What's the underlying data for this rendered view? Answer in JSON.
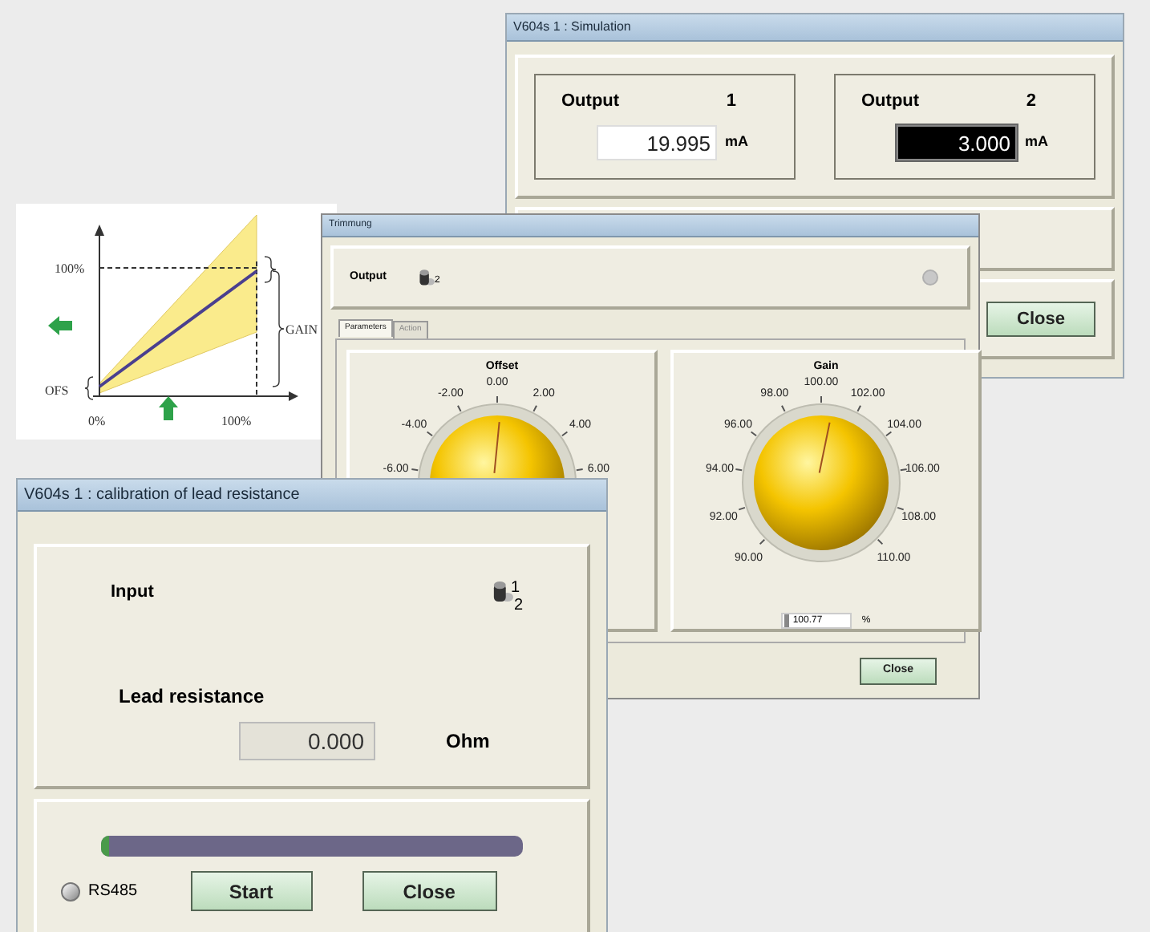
{
  "simulation_window": {
    "title": "V604s 1 : Simulation",
    "outputs": [
      {
        "label": "Output",
        "number": "1",
        "value": "19.995",
        "unit": "mA",
        "selected": false
      },
      {
        "label": "Output",
        "number": "2",
        "value": "3.000",
        "unit": "mA",
        "selected": true
      }
    ],
    "close_button": "Close"
  },
  "diagram": {
    "y_label": "100%",
    "offset_label": "OFS",
    "x_start_label": "0%",
    "x_end_label": "100%",
    "gain_label": "GAIN"
  },
  "trim_window": {
    "title": "Trimmung",
    "output_label": "Output",
    "switch_label": "2",
    "tabs": [
      {
        "label": "Parameters",
        "selected": true
      },
      {
        "label": "Action",
        "selected": false
      }
    ],
    "dials": [
      {
        "title": "Offset",
        "ticks": [
          "-6.00",
          "-4.00",
          "-2.00",
          "0.00",
          "2.00",
          "4.00",
          "6.00"
        ]
      },
      {
        "title": "Gain",
        "ticks": [
          "90.00",
          "92.00",
          "94.00",
          "96.00",
          "98.00",
          "100.00",
          "102.00",
          "104.00",
          "106.00",
          "108.00",
          "110.00"
        ],
        "value": "100.77",
        "unit": "%"
      }
    ],
    "close_button": "Close"
  },
  "calibration_window": {
    "title": "V604s 1 : calibration of lead resistance",
    "input_label": "Input",
    "switch_labels": [
      "1",
      "2"
    ],
    "lead_label": "Lead resistance",
    "lead_value": "0.000",
    "lead_unit": "Ohm",
    "progress": {
      "level": 0.02
    },
    "status_label": "RS485",
    "buttons": [
      "Start",
      "Close"
    ]
  }
}
